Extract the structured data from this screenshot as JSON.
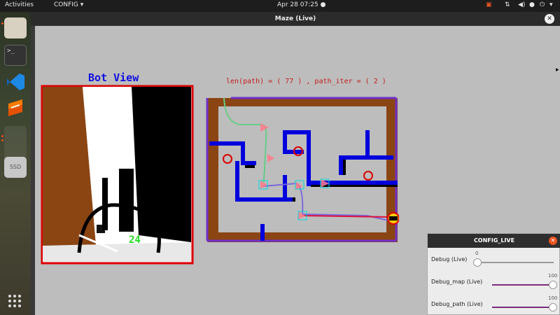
{
  "topbar": {
    "activities": "Activities",
    "app_menu": "CONFIG",
    "clock": "Apr 28  07:25"
  },
  "window": {
    "title": "Maze (Live)",
    "close_label": "✕"
  },
  "canvas": {
    "bot_view_title": "Bot View",
    "path_info": "len(path) = ( 77 ) , path_iter = ( 2 )",
    "bot_view_number": "24",
    "dock_drive_label": "SSD"
  },
  "config": {
    "title": "CONFIG_LIVE",
    "close_label": "✕",
    "sliders": [
      {
        "label": "Debug (Live)",
        "value": "0",
        "level": 0
      },
      {
        "label": "Debug_map (Live)",
        "value": "100",
        "level": 1
      },
      {
        "label": "Debug_path (Live)",
        "value": "100",
        "level": 1
      }
    ]
  },
  "colors": {
    "maze_floor": "#8b4513",
    "wall_blue": "#0000dd",
    "border_purple": "#7030c8",
    "path_red": "#dd1040",
    "accent": "#e95420"
  }
}
